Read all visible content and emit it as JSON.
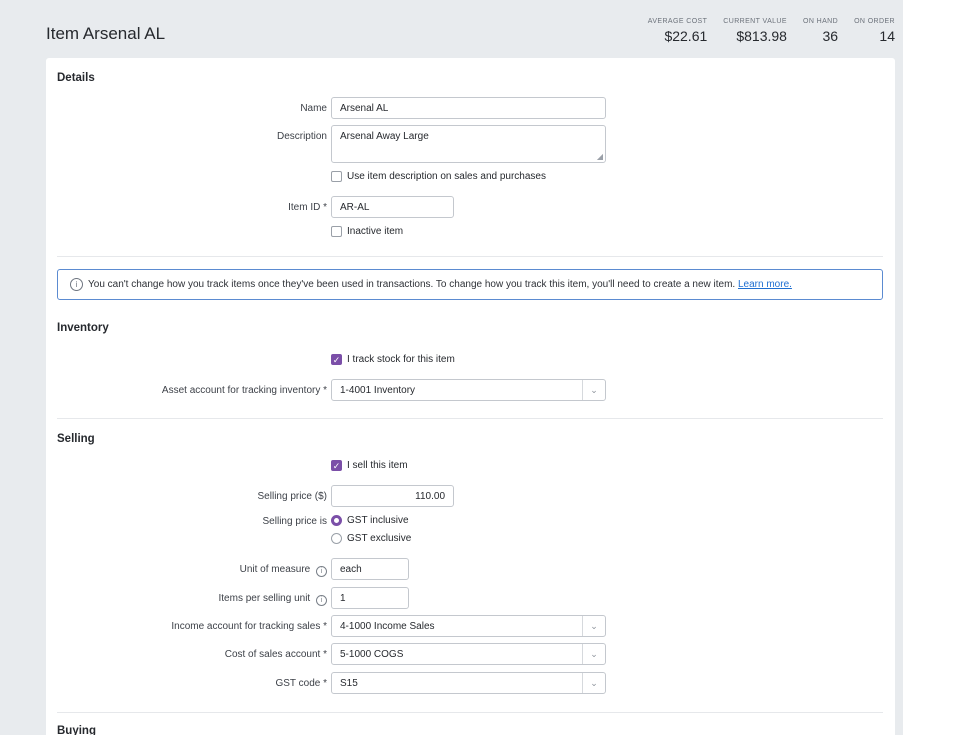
{
  "header": {
    "title": "Item Arsenal AL",
    "stats": [
      {
        "label": "Average cost",
        "value": "$22.61"
      },
      {
        "label": "Current value",
        "value": "$813.98"
      },
      {
        "label": "On hand",
        "value": "36"
      },
      {
        "label": "On order",
        "value": "14"
      }
    ]
  },
  "details": {
    "title": "Details",
    "name_label": "Name",
    "name_value": "Arsenal AL",
    "description_label": "Description",
    "description_value": "Arsenal Away Large",
    "use_description_label": "Use item description on sales and purchases",
    "item_id_label": "Item ID *",
    "item_id_value": "AR-AL",
    "inactive_label": "Inactive item"
  },
  "notice": {
    "text": "You can't change how you track items once they've been used in transactions. To change how you track this item, you'll need to create a new item.",
    "link": "Learn more."
  },
  "inventory": {
    "title": "Inventory",
    "track_label": "I track stock for this item",
    "asset_account_label": "Asset account for tracking inventory *",
    "asset_account_value": "1-4001  Inventory"
  },
  "selling": {
    "title": "Selling",
    "sell_label": "I sell this item",
    "price_label": "Selling price ($)",
    "price_value": "110.00",
    "price_is_label": "Selling price is",
    "gst_inclusive": "GST inclusive",
    "gst_exclusive": "GST exclusive",
    "uom_label": "Unit of measure",
    "uom_value": "each",
    "items_per_unit_label": "Items per selling unit",
    "items_per_unit_value": "1",
    "income_account_label": "Income account for tracking sales *",
    "income_account_value": "4-1000  Income Sales",
    "cos_account_label": "Cost of sales account *",
    "cos_account_value": "5-1000  COGS",
    "gst_code_label": "GST code *",
    "gst_code_value": "S15"
  },
  "buying": {
    "title": "Buying"
  },
  "colors": {
    "accent": "#7b4fa8",
    "link": "#1f6fd1",
    "notice_border": "#5b8bd1"
  }
}
